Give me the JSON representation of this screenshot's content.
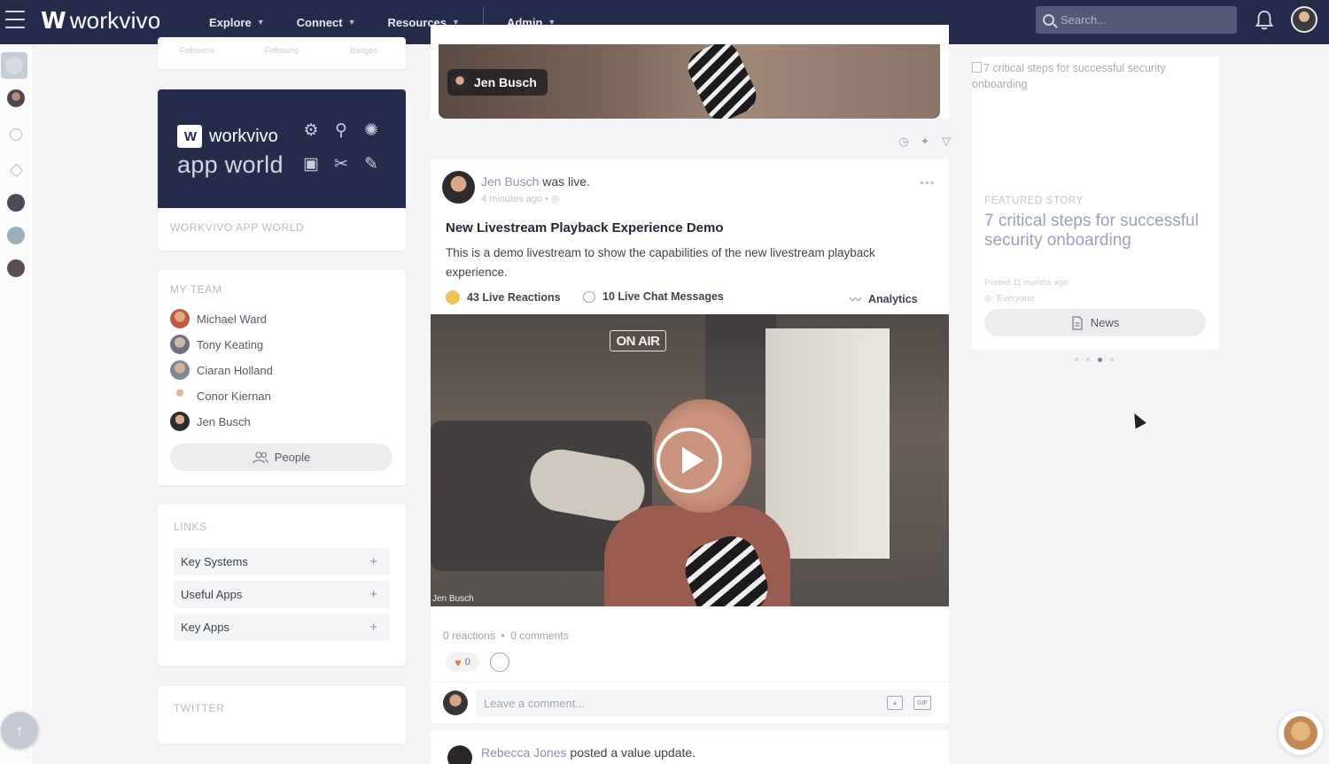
{
  "topbar": {
    "brand": "workvivo",
    "nav": [
      {
        "label": "Explore"
      },
      {
        "label": "Connect"
      },
      {
        "label": "Resources"
      },
      {
        "label": "Admin"
      }
    ],
    "search_placeholder": "Search..."
  },
  "profile_stub": {
    "stats": [
      "Followers",
      "Following",
      "Badges"
    ]
  },
  "app_world": {
    "brand": "workvivo",
    "subtitle": "app world",
    "section_label": "WORKVIVO APP WORLD"
  },
  "my_team": {
    "label": "MY TEAM",
    "members": [
      {
        "name": "Michael Ward"
      },
      {
        "name": "Tony Keating"
      },
      {
        "name": "Ciaran Holland"
      },
      {
        "name": "Conor Kiernan"
      },
      {
        "name": "Jen Busch"
      }
    ],
    "people_button": "People"
  },
  "links": {
    "label": "LINKS",
    "items": [
      {
        "label": "Key Systems"
      },
      {
        "label": "Useful Apps"
      },
      {
        "label": "Key Apps"
      }
    ]
  },
  "twitter": {
    "label": "TWITTER"
  },
  "top_video": {
    "host_name": "Jen Busch"
  },
  "post": {
    "author": "Jen Busch",
    "action": "was live.",
    "time": "4 minutes ago",
    "title": "New Livestream Playback Experience Demo",
    "body": "This is a demo livestream to show the capabilities of the new livestream playback experience.",
    "live_reactions": "43 Live Reactions",
    "live_chat": "10 Live Chat Messages",
    "analytics": "Analytics",
    "sign_text": "ON AIR",
    "video_caption": "Jen Busch",
    "reactions_count": "0 reactions",
    "comments_count": "0 comments",
    "heart_count": "0",
    "comment_placeholder": "Leave a comment...",
    "gif_label": "GIF"
  },
  "post2": {
    "author": "Rebecca Jones",
    "action": "posted a value update."
  },
  "featured": {
    "image_alt": "7 critical steps for successful security onboarding",
    "kicker": "FEATURED STORY",
    "title": "7 critical steps for successful security onboarding",
    "posted": "Posted 11 months ago",
    "audience": "Everyone",
    "button": "News"
  },
  "colors": {
    "topbar": "#242b4b",
    "accent_link": "#8a93a8"
  }
}
